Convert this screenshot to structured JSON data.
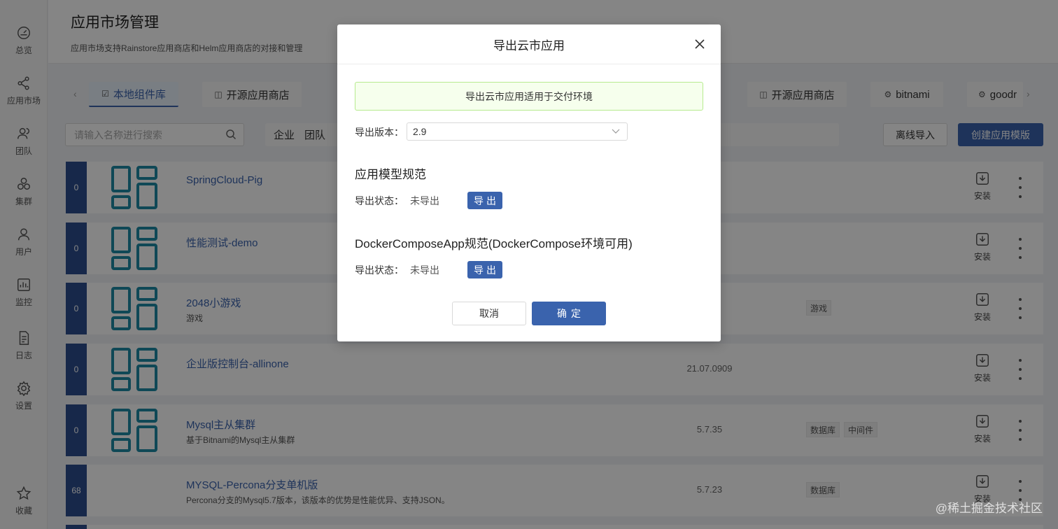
{
  "sidebar": {
    "items": [
      {
        "label": "总览",
        "icon": "gauge-icon"
      },
      {
        "label": "应用市场",
        "icon": "share-icon"
      },
      {
        "label": "团队",
        "icon": "team-icon"
      },
      {
        "label": "集群",
        "icon": "cluster-icon"
      },
      {
        "label": "用户",
        "icon": "user-icon"
      },
      {
        "label": "监控",
        "icon": "monitor-icon"
      },
      {
        "label": "日志",
        "icon": "log-icon"
      },
      {
        "label": "设置",
        "icon": "gear-icon"
      },
      {
        "label": "收藏",
        "icon": "star-icon"
      }
    ]
  },
  "header": {
    "title": "应用市场管理",
    "description": "应用市场支持Rainstore应用商店和Helm应用商店的对接和管理"
  },
  "tabs": [
    {
      "label": "本地组件库"
    },
    {
      "label": "开源应用商店"
    },
    {
      "label": "开源应用商店"
    },
    {
      "label": "bitnami"
    },
    {
      "label": "goodr"
    }
  ],
  "toolbar": {
    "search_placeholder": "请输入名称进行搜索",
    "scope_enterprise": "企业",
    "scope_team": "团队",
    "import_label": "离线导入",
    "create_label": "创建应用模版"
  },
  "apps": [
    {
      "count": "0",
      "name": "SpringCloud-Pig",
      "desc": "",
      "version": "",
      "tags": [],
      "install": "安装"
    },
    {
      "count": "0",
      "name": "性能测试-demo",
      "desc": "",
      "version": "",
      "tags": [],
      "install": "安装"
    },
    {
      "count": "0",
      "name": "2048小游戏",
      "desc": "游戏",
      "version": "",
      "tags": [
        "游戏"
      ],
      "install": "安装"
    },
    {
      "count": "0",
      "name": "企业版控制台-allinone",
      "desc": "",
      "version": "21.07.0909",
      "tags": [],
      "install": "安装"
    },
    {
      "count": "0",
      "name": "Mysql主从集群",
      "desc": "基于Bitnami的Mysql主从集群",
      "version": "5.7.35",
      "tags": [
        "数据库",
        "中间件"
      ],
      "install": "安装"
    },
    {
      "count": "68",
      "name": "MYSQL-Percona分支单机版",
      "desc": "Percona分支的Mysql5.7版本，该版本的优势是性能优异、支持JSON。",
      "version": "5.7.23",
      "tags": [
        "数据库"
      ],
      "install": "安装"
    }
  ],
  "modal": {
    "title": "导出云市应用",
    "alert": "导出云市应用适用于交付环境",
    "version_label": "导出版本：",
    "version_value": "2.9",
    "section1_title": "应用模型规范",
    "section1_status_label": "导出状态：",
    "section1_status_value": "未导出",
    "section1_button": "导出",
    "section2_title": "DockerComposeApp规范(DockerCompose环境可用)",
    "section2_status_label": "导出状态：",
    "section2_status_value": "未导出",
    "section2_button": "导出",
    "cancel_label": "取消",
    "ok_label": "确定"
  },
  "watermark": "@稀土掘金技术社区",
  "colors": {
    "primary": "#3a63ad",
    "count_bg": "#2d4e8e",
    "logo": "#1d8aa5",
    "alert_bg": "#f6ffed"
  }
}
